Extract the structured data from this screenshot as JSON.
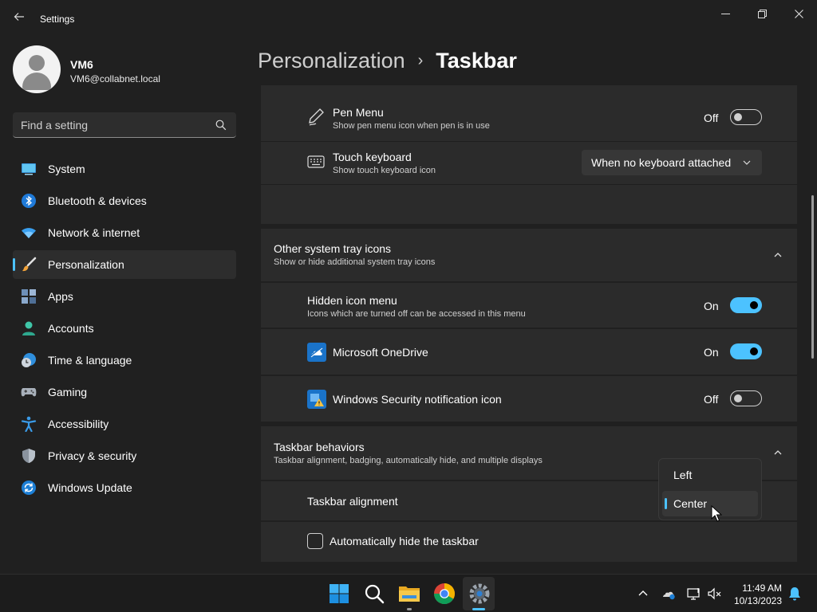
{
  "window": {
    "title": "Settings",
    "back_icon": "back-arrow-icon",
    "controls": [
      "minimize-icon",
      "restore-icon",
      "close-icon"
    ]
  },
  "profile": {
    "name": "VM6",
    "email": "VM6@collabnet.local"
  },
  "search": {
    "placeholder": "Find a setting",
    "value": ""
  },
  "nav": {
    "items": [
      {
        "label": "System",
        "icon": "system-monitor-icon",
        "selected": false
      },
      {
        "label": "Bluetooth & devices",
        "icon": "bluetooth-icon",
        "selected": false
      },
      {
        "label": "Network & internet",
        "icon": "wifi-icon",
        "selected": false
      },
      {
        "label": "Personalization",
        "icon": "paintbrush-icon",
        "selected": true
      },
      {
        "label": "Apps",
        "icon": "apps-icon",
        "selected": false
      },
      {
        "label": "Accounts",
        "icon": "accounts-icon",
        "selected": false
      },
      {
        "label": "Time & language",
        "icon": "time-language-icon",
        "selected": false
      },
      {
        "label": "Gaming",
        "icon": "gamepad-icon",
        "selected": false
      },
      {
        "label": "Accessibility",
        "icon": "accessibility-icon",
        "selected": false
      },
      {
        "label": "Privacy & security",
        "icon": "shield-icon",
        "selected": false
      },
      {
        "label": "Windows Update",
        "icon": "windows-update-icon",
        "selected": false
      }
    ]
  },
  "header": {
    "parent": "Personalization",
    "separator": "›",
    "current": "Taskbar"
  },
  "pen_menu": {
    "label": "Pen Menu",
    "description": "Show pen menu icon when pen is in use",
    "state_text": "Off",
    "on": false
  },
  "touch_keyboard": {
    "label": "Touch keyboard",
    "description": "Show touch keyboard icon",
    "selected_option": "When no keyboard attached"
  },
  "other_tray": {
    "title": "Other system tray icons",
    "description": "Show or hide additional system tray icons",
    "items": [
      {
        "label": "Hidden icon menu",
        "description": "Icons which are turned off can be accessed in this menu",
        "state_text": "On",
        "on": true
      },
      {
        "label": "Microsoft OneDrive",
        "state_text": "On",
        "on": true
      },
      {
        "label": "Windows Security notification icon",
        "state_text": "Off",
        "on": false
      }
    ]
  },
  "behaviors": {
    "title": "Taskbar behaviors",
    "description": "Taskbar alignment, badging, automatically hide, and multiple displays",
    "alignment_label": "Taskbar alignment",
    "alignment_options": [
      "Left",
      "Center"
    ],
    "alignment_selected": "Center",
    "autohide_label": "Automatically hide the taskbar",
    "autohide_checked": false
  },
  "taskbar": {
    "apps": [
      "start-icon",
      "search-icon",
      "file-explorer-icon",
      "chrome-icon",
      "settings-icon"
    ],
    "clock": {
      "time": "11:49 AM",
      "date": "10/13/2023"
    }
  },
  "colors": {
    "accent": "#4cc2ff",
    "background": "#202020",
    "card": "#2b2b2b"
  }
}
